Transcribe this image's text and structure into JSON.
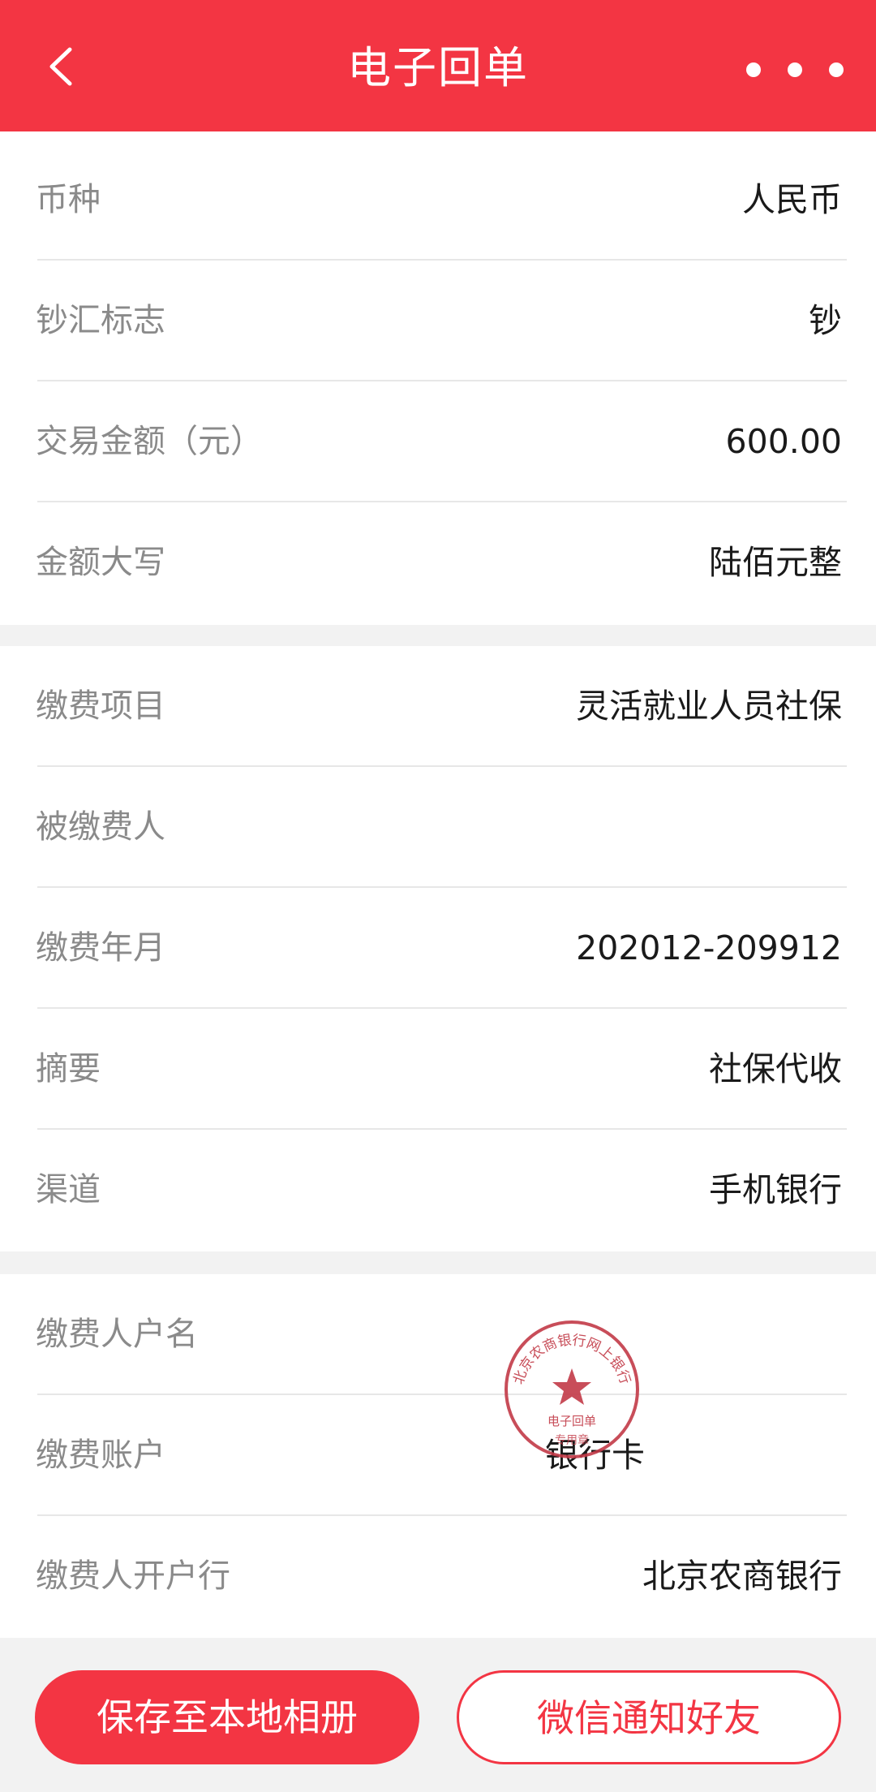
{
  "colors": {
    "accent": "#f33543",
    "label": "#8a8a8a",
    "value": "#1a1a1a"
  },
  "header": {
    "title": "电子回单",
    "back_icon": "chevron-left-icon",
    "more_icon": "more-horizontal-icon"
  },
  "section1": [
    {
      "label": "币种",
      "value": "人民币"
    },
    {
      "label": "钞汇标志",
      "value": "钞"
    },
    {
      "label": "交易金额（元）",
      "value": "600.00"
    },
    {
      "label": "金额大写",
      "value": "陆佰元整"
    }
  ],
  "section2": [
    {
      "label": "缴费项目",
      "value": "灵活就业人员社保"
    },
    {
      "label": "被缴费人",
      "value": ""
    },
    {
      "label": "缴费年月",
      "value": "202012-209912"
    },
    {
      "label": "摘要",
      "value": "社保代收"
    },
    {
      "label": "渠道",
      "value": "手机银行"
    }
  ],
  "section3": [
    {
      "label": "缴费人户名",
      "value": ""
    },
    {
      "label": "缴费账户",
      "value": "银行卡"
    },
    {
      "label": "缴费人开户行",
      "value": "北京农商银行"
    }
  ],
  "seal": {
    "icon": "seal-stamp-icon",
    "outer_text": "北京农商银行网上银行",
    "inner_text": "电子回单",
    "bottom_text": "专用章"
  },
  "actions": {
    "save_label": "保存至本地相册",
    "share_label": "微信通知好友"
  }
}
